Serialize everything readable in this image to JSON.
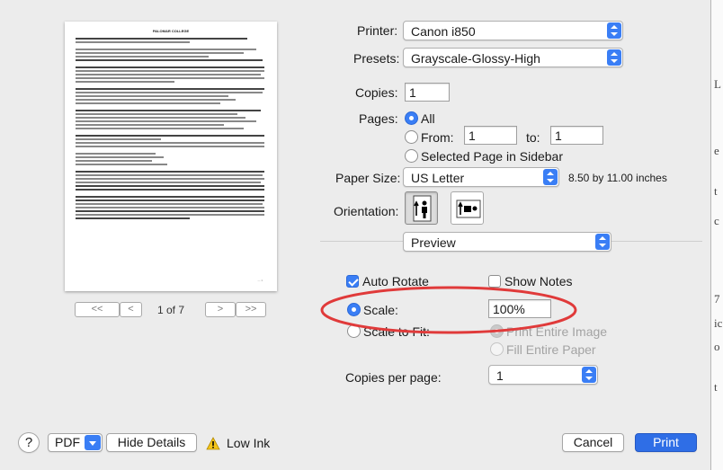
{
  "preview": {
    "doc_title": "PALOMAR COLLEGE",
    "page_indicator": "1 of 7",
    "first_page_label": "<<",
    "prev_page_label": "<",
    "next_page_label": ">",
    "last_page_label": ">>"
  },
  "printer": {
    "label": "Printer:",
    "value": "Canon i850"
  },
  "presets": {
    "label": "Presets:",
    "value": "Grayscale-Glossy-High"
  },
  "copies": {
    "label": "Copies:",
    "value": "1"
  },
  "pages": {
    "label": "Pages:",
    "all_label": "All",
    "from_label": "From:",
    "from_value": "1",
    "to_label": "to:",
    "to_value": "1",
    "selected_label": "Selected Page in Sidebar"
  },
  "paper_size": {
    "label": "Paper Size:",
    "value": "US Letter",
    "dimensions": "8.50 by 11.00 inches"
  },
  "orientation": {
    "label": "Orientation:"
  },
  "section": {
    "value": "Preview"
  },
  "options": {
    "auto_rotate": "Auto Rotate",
    "show_notes": "Show Notes",
    "scale_label": "Scale:",
    "scale_value": "100%",
    "scale_to_fit": "Scale to Fit:",
    "print_entire_image": "Print Entire Image",
    "fill_entire_paper": "Fill Entire Paper",
    "copies_per_page_label": "Copies per page:",
    "copies_per_page_value": "1"
  },
  "footer": {
    "help": "?",
    "pdf": "PDF",
    "hide_details": "Hide Details",
    "low_ink": "Low Ink",
    "cancel": "Cancel",
    "print": "Print"
  },
  "background_glyphs": [
    "L",
    "e",
    "t",
    "c",
    "7",
    "ic",
    "o",
    "t"
  ],
  "colors": {
    "accent": "#3a7ef5",
    "annotation_circle": "#e03a3a",
    "print_button": "#2f6ee6"
  }
}
